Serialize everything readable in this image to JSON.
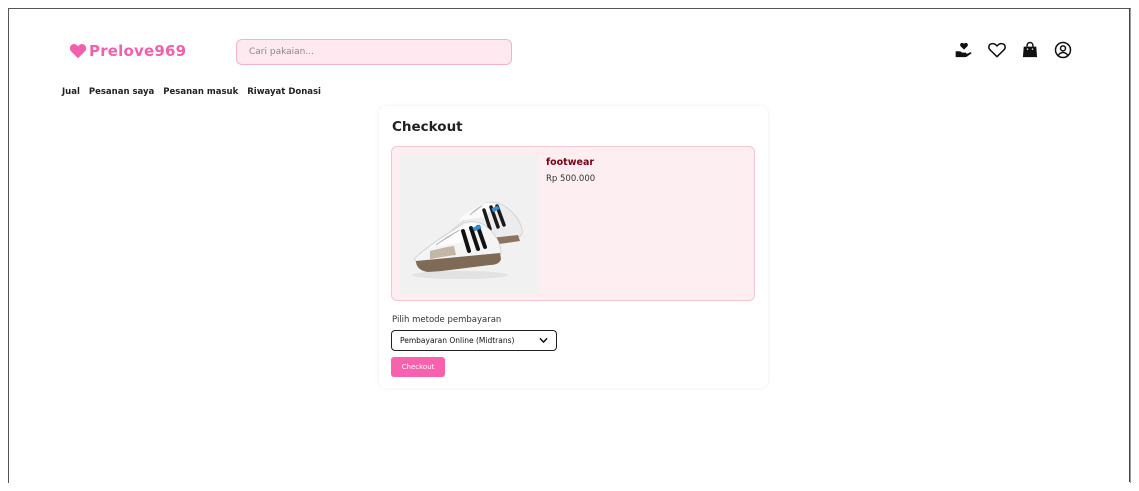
{
  "brand": {
    "name": "Prelove969",
    "color": "#f25fab"
  },
  "search": {
    "placeholder": "Cari pakaian..."
  },
  "header_icons": [
    "donate-hand-heart-icon",
    "heart-icon",
    "shopping-bag-icon",
    "user-circle-icon"
  ],
  "nav": {
    "items": [
      "Jual",
      "Pesanan saya",
      "Pesanan masuk",
      "Riwayat Donasi"
    ]
  },
  "checkout": {
    "title": "Checkout",
    "product": {
      "name": "footwear",
      "price": "Rp 500.000",
      "image": "sneaker-photo"
    },
    "payment_label": "Pilih metode pembayaran",
    "payment_selected": "Pembayaran Online (Midtrans)",
    "button_label": "Checkout",
    "accent": "#f861ae"
  }
}
